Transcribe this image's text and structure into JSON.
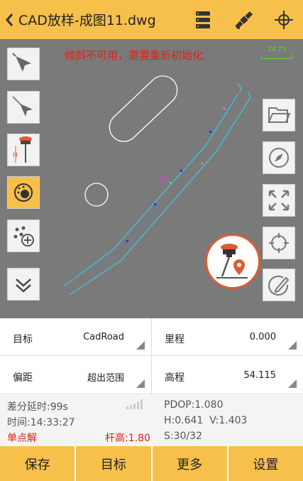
{
  "header": {
    "back_glyph": "<",
    "title": "CAD放样-成图11.dwg",
    "icons": [
      "layers-icon",
      "satellite-icon",
      "crosshair-icon"
    ]
  },
  "map": {
    "warning": "倾斜不可用，需要重新初始化",
    "scale_label": "24.73",
    "left_tools": [
      "select-arrow-icon",
      "line-select-icon",
      "rover-height-icon",
      "target-location-icon",
      "add-points-icon",
      "collapse-down-icon"
    ],
    "right_tools": [
      "folder-icon",
      "compass-icon",
      "fullscreen-icon",
      "locate-icon",
      "edit-icon"
    ]
  },
  "info": {
    "target_label": "目标",
    "target_value": "CadRoad",
    "mileage_label": "里程",
    "mileage_value": "0.000",
    "offset_label": "偏距",
    "offset_value": "超出范围",
    "elevation_label": "高程",
    "elevation_value": "54.115"
  },
  "status": {
    "diff_delay": "差分延时:99s",
    "time": "时间:14:33:27",
    "solution": "单点解",
    "pole_height": "杆高:1.80",
    "pdop": "PDOP:1.080",
    "hv": "H:0.641  V:1.403",
    "sats": "S:30/32"
  },
  "bottom": {
    "save": "保存",
    "target": "目标",
    "more": "更多",
    "settings": "设置"
  },
  "colors": {
    "accent": "#f7c04a",
    "warning": "#e0201b",
    "map_bg": "#7a7a7a",
    "road": "#38c8e0"
  }
}
